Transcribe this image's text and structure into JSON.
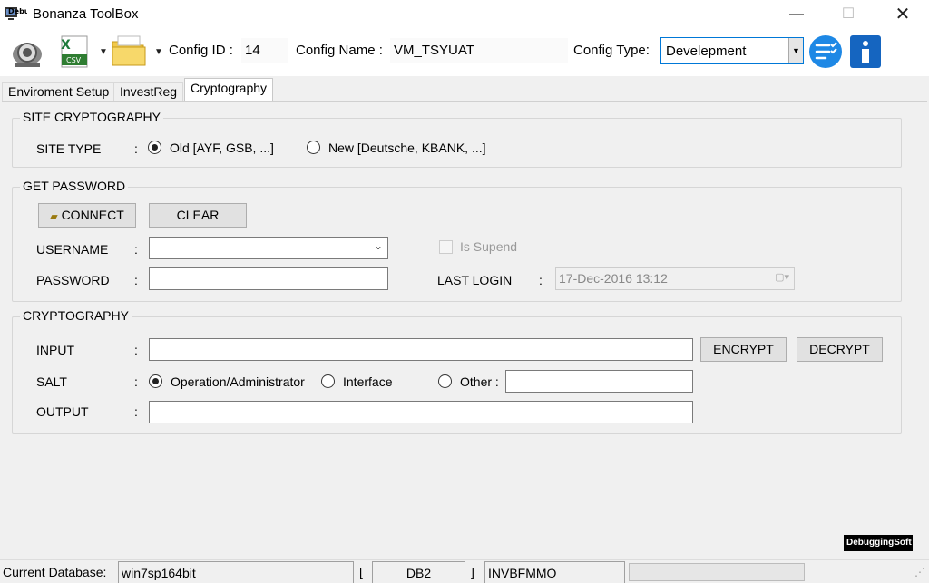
{
  "window": {
    "title": "Bonanza ToolBox",
    "icon": "debugging-soft-logo",
    "logo_text": "DebuggingSoft"
  },
  "toolbar": {
    "config_id_label": "Config ID :",
    "config_id_value": "14",
    "config_name_label": "Config Name :",
    "config_name_value": "VM_TSYUAT",
    "config_type_label": "Config Type:",
    "config_type_value": "Develepment",
    "csv_text": "CSV"
  },
  "tabs": [
    {
      "label": "Enviroment Setup"
    },
    {
      "label": "InvestReg"
    },
    {
      "label": "Cryptography"
    }
  ],
  "site_cryptography": {
    "title": "SITE CRYPTOGRAPHY",
    "site_type_label": "SITE TYPE",
    "colon": ":",
    "option_old": "Old [AYF, GSB, ...]",
    "option_new": "New [Deutsche, KBANK, ...]"
  },
  "get_password": {
    "title": "GET PASSWORD",
    "connect_label": "CONNECT",
    "clear_label": "CLEAR",
    "username_label": "USERNAME",
    "password_label": "PASSWORD",
    "colon": ":",
    "is_suspend_label": "Is Supend",
    "last_login_label": "LAST LOGIN",
    "last_login_value": "17-Dec-2016 13:12"
  },
  "cryptography": {
    "title": "CRYPTOGRAPHY",
    "input_label": "INPUT",
    "salt_label": "SALT",
    "output_label": "OUTPUT",
    "colon": ":",
    "encrypt_label": "ENCRYPT",
    "decrypt_label": "DECRYPT",
    "salt_operation": "Operation/Administrator",
    "salt_interface": "Interface",
    "salt_other": "Other :"
  },
  "statusbar": {
    "current_db_label": "Current Database:",
    "current_db_value": "win7sp164bit",
    "bracket_open": "[",
    "db_type": "DB2",
    "bracket_close": "]",
    "db_name": "INVBFMMO"
  },
  "colors": {
    "accent": "#0078d7",
    "info_icon": "#1565c0",
    "list_icon": "#1e88e5"
  }
}
